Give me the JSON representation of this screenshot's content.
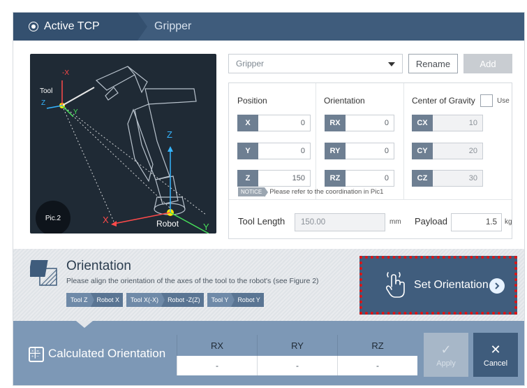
{
  "tabs": {
    "active_label": "Active TCP",
    "second_label": "Gripper"
  },
  "diagram": {
    "axis_neg_x": "-X",
    "tool_label": "Tool",
    "tool_z": "Z",
    "tool_y": "Y",
    "robot_z": "Z",
    "robot_x": "X",
    "robot_y": "Y",
    "robot_label": "Robot",
    "pic_label": "Pic.2"
  },
  "tool_select": {
    "value": "Gripper",
    "rename_label": "Rename",
    "add_label": "Add"
  },
  "position": {
    "header": "Position",
    "fields": [
      {
        "label": "X",
        "value": "0"
      },
      {
        "label": "Y",
        "value": "0"
      },
      {
        "label": "Z",
        "value": "150"
      }
    ]
  },
  "orientation_fields": {
    "header": "Orientation",
    "fields": [
      {
        "label": "RX",
        "value": "0"
      },
      {
        "label": "RY",
        "value": "0"
      },
      {
        "label": "RZ",
        "value": "0"
      }
    ]
  },
  "center_of_gravity": {
    "header": "Center of Gravity",
    "use_label": "Use",
    "use_checked": false,
    "fields": [
      {
        "label": "CX",
        "value": "10"
      },
      {
        "label": "CY",
        "value": "20"
      },
      {
        "label": "CZ",
        "value": "30"
      }
    ]
  },
  "notice": {
    "tag": "NOTICE",
    "text": "Please refer to the coordination in Pic1"
  },
  "tool_length": {
    "label": "Tool Length",
    "value": "150.00",
    "unit": "mm"
  },
  "payload": {
    "label": "Payload",
    "value": "1.5",
    "unit": "kg"
  },
  "orientation_section": {
    "title": "Orientation",
    "description": "Please align the orientation of the axes of the tool to the robot's (see Figure 2)",
    "chips": [
      {
        "tool": "Tool Z",
        "robot": "Robot X"
      },
      {
        "tool": "Tool X(-X)",
        "robot": "Robot -Z(Z)"
      },
      {
        "tool": "Tool Y",
        "robot": "Robot Y"
      }
    ],
    "set_button_label": "Set Orientation"
  },
  "calculated": {
    "title": "Calculated Orientation",
    "headers": [
      "RX",
      "RY",
      "RZ"
    ],
    "values": [
      "-",
      "-",
      "-"
    ]
  },
  "actions": {
    "apply_label": "Apply",
    "cancel_label": "Cancel"
  },
  "colors": {
    "header_bg": "#3f5c7c",
    "field_label_bg": "#6e7f92",
    "calc_band": "#7d98b6",
    "highlight_border": "#e01414",
    "tool_point": "#ffe600",
    "axis_cyan": "#35b5ff",
    "axis_green": "#47e05a",
    "axis_red": "#ff4a4a"
  }
}
